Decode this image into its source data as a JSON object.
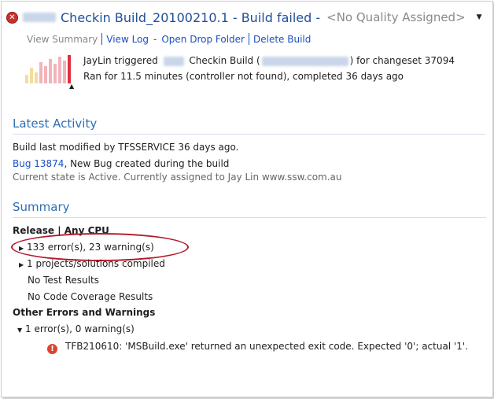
{
  "header": {
    "title_prefix": "Checkin Build_20100210.1 - Build failed -",
    "quality": "<No Quality Assigned>",
    "dropdown_icon": "triangle-down-icon"
  },
  "links": {
    "view_summary": "View Summary",
    "view_log": "View Log",
    "open_drop_folder": "Open Drop Folder",
    "delete_build": "Delete Build"
  },
  "build_info": {
    "line1_user": "JayLin triggered",
    "line1_mid": "Checkin Build (",
    "line1_end": ") for changeset 37094",
    "line2": "Ran for 11.5 minutes (controller not found), completed 36 days ago"
  },
  "history_bars": [
    {
      "status": "partial",
      "color": "#f3dca0",
      "level": 0.3
    },
    {
      "status": "partial",
      "color": "#f3dca0",
      "level": 0.55
    },
    {
      "status": "partial",
      "color": "#f3dca0",
      "level": 0.4
    },
    {
      "status": "failed",
      "color": "#f2b3bb",
      "level": 0.75
    },
    {
      "status": "failed",
      "color": "#f2b3bb",
      "level": 0.6
    },
    {
      "status": "failed",
      "color": "#f2b3bb",
      "level": 0.85
    },
    {
      "status": "failed",
      "color": "#f2b3bb",
      "level": 0.7
    },
    {
      "status": "failed",
      "color": "#f2b3bb",
      "level": 0.95
    },
    {
      "status": "failed",
      "color": "#f2b3bb",
      "level": 0.8
    },
    {
      "status": "failed-current",
      "color": "#e03040",
      "level": 1.0
    }
  ],
  "latest_activity": {
    "heading": "Latest Activity",
    "modified": "Build last modified by TFSSERVICE 36 days ago.",
    "bug_link": "Bug 13874",
    "bug_text": ", New Bug created during the build",
    "bug_state": "Current state is Active. Currently assigned to Jay Lin www.ssw.com.au"
  },
  "summary": {
    "heading": "Summary",
    "config": "Release | Any CPU",
    "errors": "133 error(s), 23 warning(s)",
    "projects": "1 projects/solutions compiled",
    "tests": "No Test Results",
    "coverage": "No Code Coverage Results",
    "other_heading": "Other Errors and Warnings",
    "other_count": "1 error(s), 0 warning(s)",
    "error_detail": "TFB210610: 'MSBuild.exe' returned an unexpected exit code. Expected '0'; actual '1'.",
    "annotation_color": "#b3192a"
  }
}
